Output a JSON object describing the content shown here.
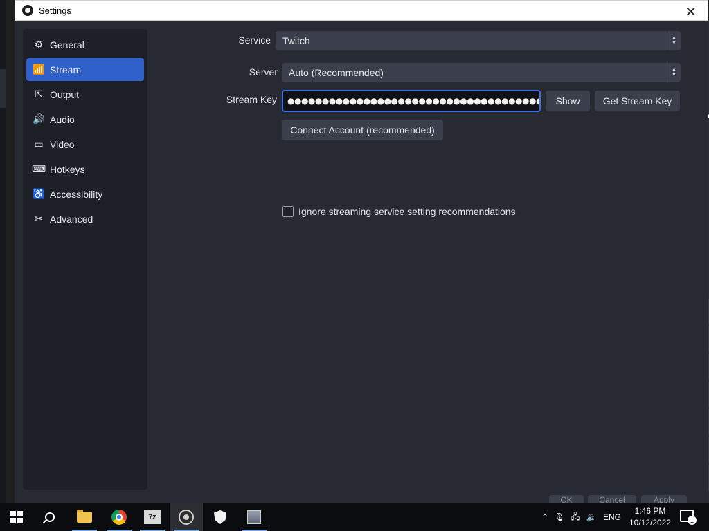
{
  "window": {
    "title": "Settings"
  },
  "sidebar": {
    "items": [
      {
        "label": "General",
        "icon": "gear-icon"
      },
      {
        "label": "Stream",
        "icon": "antenna-icon",
        "active": true
      },
      {
        "label": "Output",
        "icon": "output-icon"
      },
      {
        "label": "Audio",
        "icon": "speaker-icon"
      },
      {
        "label": "Video",
        "icon": "monitor-icon"
      },
      {
        "label": "Hotkeys",
        "icon": "keyboard-icon"
      },
      {
        "label": "Accessibility",
        "icon": "accessibility-icon"
      },
      {
        "label": "Advanced",
        "icon": "tools-icon"
      }
    ]
  },
  "stream": {
    "service_label": "Service",
    "service_value": "Twitch",
    "server_label": "Server",
    "server_value": "Auto (Recommended)",
    "key_label": "Stream Key",
    "key_value": "●●●●●●●●●●●●●●●●●●●●●●●●●●●●●●●●●●●●●●●●●●●●●●●●●●●●●●●●",
    "show_button": "Show",
    "get_key_button": "Get Stream Key",
    "connect_button": "Connect Account (recommended)",
    "ignore_checkbox_label": "Ignore streaming service setting recommendations",
    "ignore_checked": false
  },
  "footer_buttons": [
    "OK",
    "Cancel",
    "Apply"
  ],
  "taskbar": {
    "apps": [
      "start-icon",
      "search-icon",
      "file-explorer-icon",
      "chrome-icon",
      "7zip-icon",
      "obs-icon",
      "security-icon",
      "app-icon"
    ],
    "sevenzip_label": "7z",
    "language": "ENG",
    "time": "1:46 PM",
    "date": "10/12/2022",
    "notification_count": "1"
  },
  "colors": {
    "accent": "#2f5fc9",
    "focus": "#3d6fe0",
    "panel": "#272a33",
    "sidebar": "#1e2028"
  }
}
